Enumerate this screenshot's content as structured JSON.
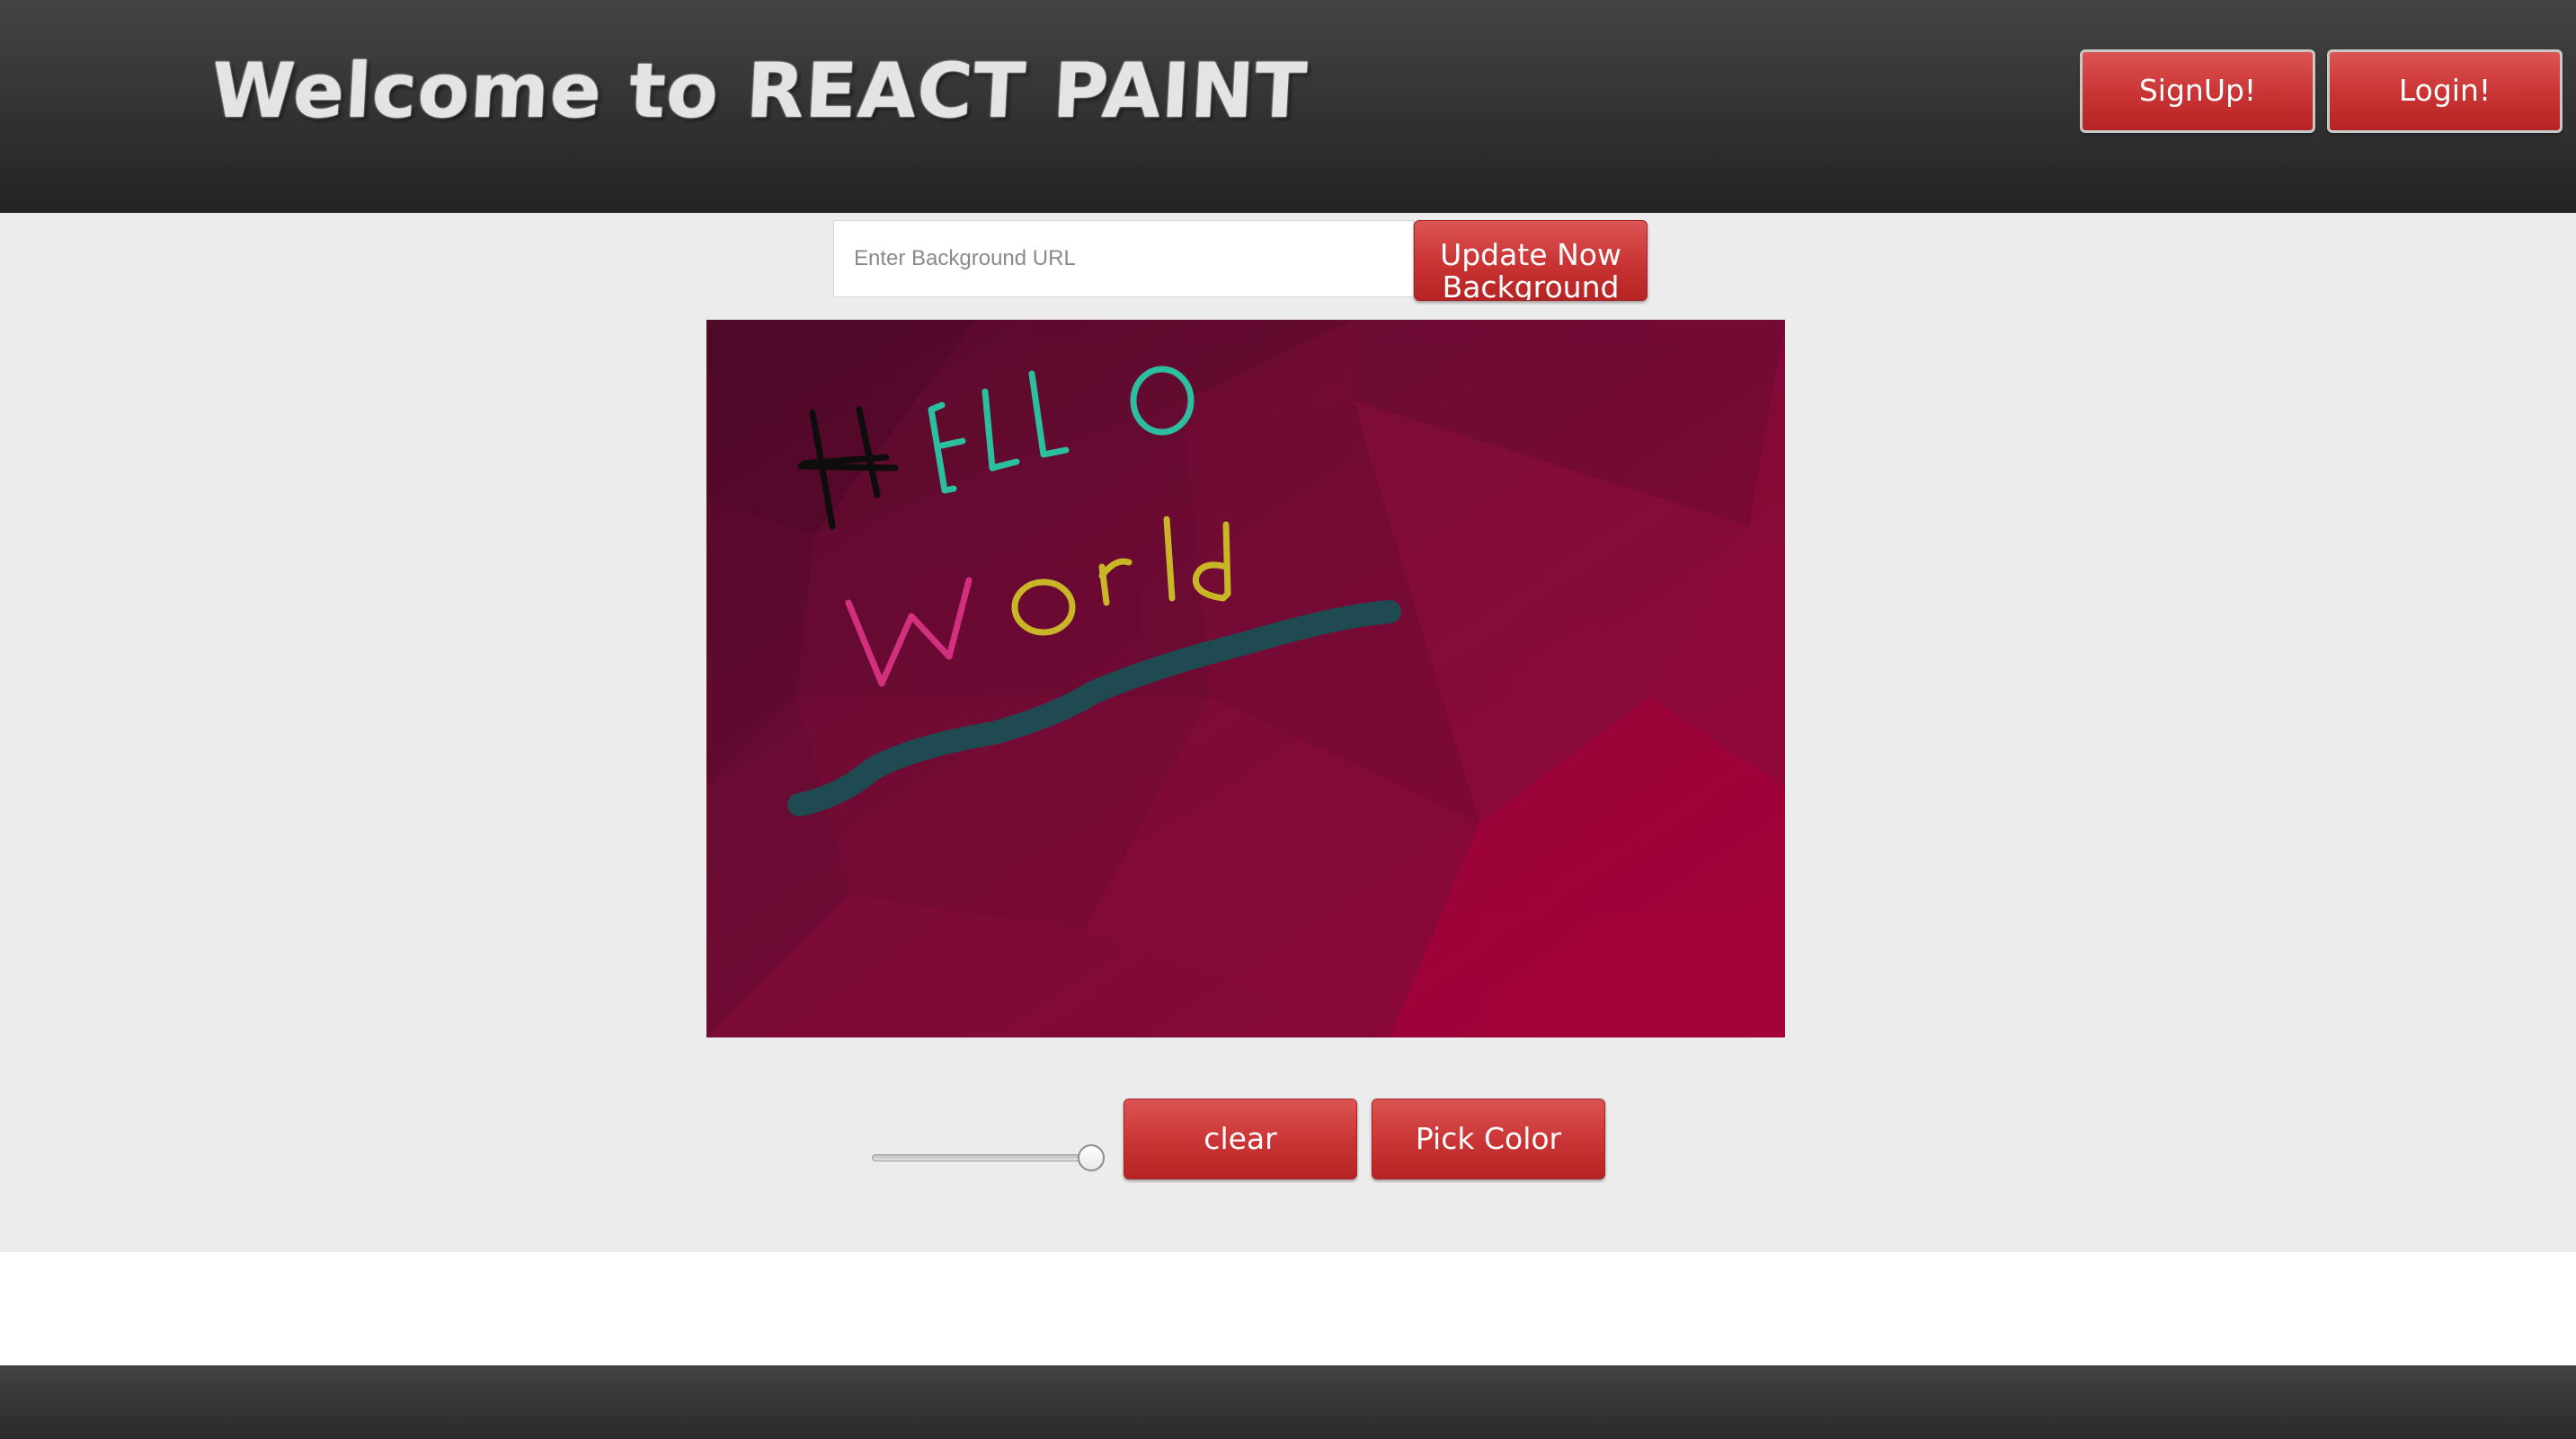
{
  "header": {
    "title": "Welcome to REACT PAINT",
    "signup_label": "SignUp!",
    "login_label": "Login!"
  },
  "background_form": {
    "url_placeholder": "Enter Background URL",
    "url_value": "",
    "update_label": "Update Now Background"
  },
  "canvas": {
    "background_colors": [
      "#5a0a2e",
      "#7a0c35",
      "#9a0a3a",
      "#a80038"
    ],
    "drawn_text": [
      {
        "text": "HELLO",
        "colors": {
          "H": "#0d0d0d",
          "ELLO": "#2bbfa0"
        }
      },
      {
        "text": "World",
        "colors": {
          "W": "#d2307f",
          "orld": "#c9b627"
        }
      }
    ],
    "stroke_color": "#1f4a52"
  },
  "controls": {
    "brush_size_level": 1.0,
    "clear_label": "clear",
    "pick_color_label": "Pick Color"
  },
  "colors": {
    "accent": "#c93333",
    "header_bg": "#333333",
    "main_bg": "#ececec"
  }
}
